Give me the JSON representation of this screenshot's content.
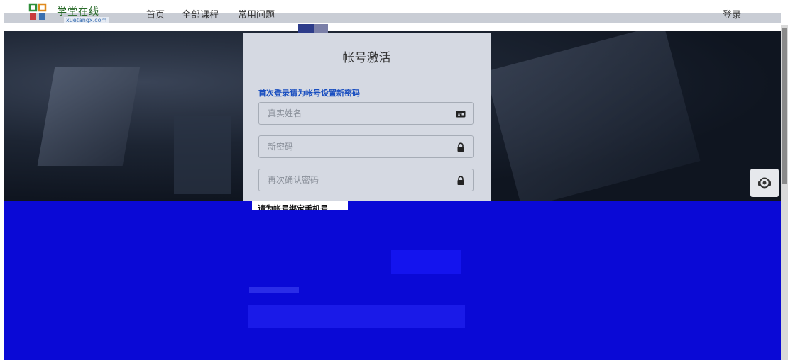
{
  "header": {
    "logo_text": "学堂在线",
    "logo_domain": "xuetangx.com",
    "nav": [
      "首页",
      "全部课程",
      "常用问题"
    ],
    "login_label": "登录"
  },
  "card": {
    "title": "帐号激活",
    "subtitle": "首次登录请为帐号设置新密码",
    "fields": [
      {
        "placeholder": "真实姓名",
        "icon": "id-card-icon"
      },
      {
        "placeholder": "新密码",
        "icon": "lock-icon"
      },
      {
        "placeholder": "再次确认密码",
        "icon": "lock-icon"
      }
    ],
    "phone_label": "请为帐号绑定手机号"
  },
  "support": {
    "icon": "headset-icon"
  },
  "colors": {
    "accent_blue": "#1a4fc0",
    "overlay_blue": "#0a09d6",
    "card_bg": "#d5d9e2"
  }
}
